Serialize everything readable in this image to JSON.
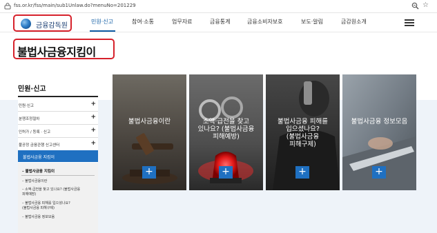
{
  "browser": {
    "url": "fss.or.kr/fss/main/sub1Unlaw.do?menuNo=201229",
    "zoom_icon": "zoom-icon",
    "bookmark_icon": "star-icon"
  },
  "header": {
    "logo_text": "금융감독원",
    "nav": [
      "민원·신고",
      "참여·소통",
      "업무자료",
      "금융통계",
      "금융소비자보호",
      "보도·알림",
      "금감원소개"
    ],
    "active_nav": "민원·신고",
    "menu_icon": "hamburger-icon"
  },
  "page": {
    "title": "불법사금융지킴이"
  },
  "sidebar": {
    "title": "민원·신고",
    "items": [
      "민원·신고",
      "분쟁조정절차",
      "인허가 / 등록 · 신고",
      "불공정 금융관행 신고센터"
    ],
    "active_item": "불법사금융 지킴이",
    "sub_head": "불법사금융 지킴이",
    "sub_items": [
      "불법사금융이란",
      "소액·급전을 찾고 있나요? (불법사금융|피해예방)",
      "불법사금융 피해를 입으셨나요?|(불법사금융 피해구제)",
      "불법사금융 정보모음"
    ]
  },
  "cards": [
    {
      "lines": [
        "불법사금융이란"
      ]
    },
    {
      "lines": [
        "소액·급전을 찾고",
        "있나요? (불법사금융",
        "피해예방)"
      ]
    },
    {
      "lines": [
        "불법사금융 피해를",
        "입으셨나요?",
        "(불법사금융",
        "피해구제)"
      ]
    },
    {
      "lines": [
        "불법사금융 정보모음"
      ]
    }
  ],
  "colors": {
    "brand_blue": "#1f70c1",
    "highlight_red": "#d6202a",
    "band": "#eef3f9"
  }
}
